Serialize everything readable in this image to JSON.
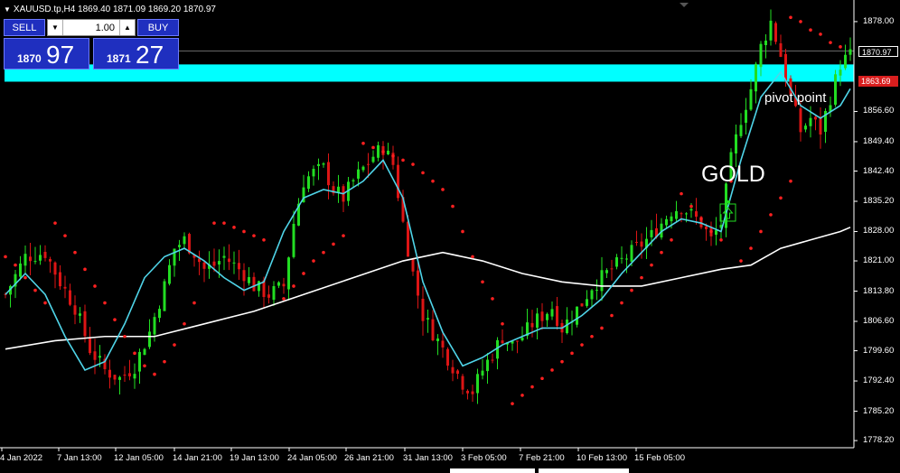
{
  "header": {
    "symbol_info": "XAUUSD.tp,H4  1869.40 1871.09 1869.20 1870.97"
  },
  "trade_panel": {
    "sell_label": "SELL",
    "buy_label": "BUY",
    "lot_value": "1.00",
    "sell_price_small": "1870",
    "sell_price_big": "97",
    "buy_price_small": "1871",
    "buy_price_big": "27"
  },
  "annotations": {
    "pivot_label": "pivot point",
    "gold_label": "GOLD"
  },
  "colors": {
    "background": "#000000",
    "bull_candle": "#22dd22",
    "bear_candle": "#dd1515",
    "ema_fast": "#4fd4e8",
    "ma_slow": "#ffffff",
    "sar": "#ff2020",
    "pivot_zone": "#00ffff",
    "pivot_tag": "#d91e1e",
    "signal_box": "#22dd22"
  },
  "chart_data": {
    "type": "candlestick",
    "price_axis": [
      "1878.00",
      "1870.97",
      "1863.69",
      "1856.60",
      "1849.40",
      "1842.40",
      "1835.20",
      "1828.00",
      "1821.00",
      "1813.80",
      "1806.60",
      "1799.60",
      "1792.40",
      "1785.20",
      "1778.20"
    ],
    "current_price": "1870.97",
    "pivot_price": "1863.69",
    "ylim": [
      1776.5,
      1882.5
    ],
    "pivot_zone": [
      1863.69,
      1867.8
    ],
    "time_axis": [
      "4 Jan 2022",
      "7 Jan 13:00",
      "12 Jan 05:00",
      "14 Jan 21:00",
      "19 Jan 13:00",
      "24 Jan 05:00",
      "26 Jan 21:00",
      "31 Jan 13:00",
      "3 Feb 05:00",
      "7 Feb 21:00",
      "10 Feb 13:00",
      "15 Feb 05:00"
    ],
    "close_path": [
      [
        0,
        1813
      ],
      [
        4,
        1822
      ],
      [
        8,
        1823
      ],
      [
        11,
        1816
      ],
      [
        14,
        1810
      ],
      [
        17,
        1800
      ],
      [
        20,
        1795
      ],
      [
        23,
        1793
      ],
      [
        26,
        1796
      ],
      [
        29,
        1804
      ],
      [
        32,
        1815
      ],
      [
        34,
        1824
      ],
      [
        36,
        1826
      ],
      [
        38,
        1823
      ],
      [
        40,
        1819
      ],
      [
        42,
        1820
      ],
      [
        44,
        1822
      ],
      [
        46,
        1820
      ],
      [
        48,
        1818
      ],
      [
        50,
        1815
      ],
      [
        53,
        1813
      ],
      [
        56,
        1815
      ],
      [
        58,
        1830
      ],
      [
        60,
        1840
      ],
      [
        62,
        1842
      ],
      [
        64,
        1843
      ],
      [
        66,
        1838
      ],
      [
        68,
        1836
      ],
      [
        70,
        1840
      ],
      [
        72,
        1843
      ],
      [
        74,
        1846
      ],
      [
        76,
        1848
      ],
      [
        78,
        1844
      ],
      [
        80,
        1830
      ],
      [
        82,
        1818
      ],
      [
        84,
        1808
      ],
      [
        86,
        1804
      ],
      [
        88,
        1800
      ],
      [
        90,
        1796
      ],
      [
        92,
        1792
      ],
      [
        94,
        1790
      ],
      [
        96,
        1795
      ],
      [
        98,
        1799
      ],
      [
        100,
        1803
      ],
      [
        102,
        1801
      ],
      [
        104,
        1803
      ],
      [
        106,
        1806
      ],
      [
        108,
        1808
      ],
      [
        110,
        1810
      ],
      [
        112,
        1805
      ],
      [
        114,
        1808
      ],
      [
        116,
        1811
      ],
      [
        118,
        1815
      ],
      [
        120,
        1817
      ],
      [
        122,
        1819
      ],
      [
        124,
        1821
      ],
      [
        126,
        1823
      ],
      [
        128,
        1825
      ],
      [
        130,
        1827
      ],
      [
        132,
        1830
      ],
      [
        134,
        1833
      ],
      [
        136,
        1834
      ],
      [
        138,
        1832
      ],
      [
        140,
        1830
      ],
      [
        142,
        1826
      ],
      [
        144,
        1830
      ],
      [
        146,
        1845
      ],
      [
        148,
        1855
      ],
      [
        150,
        1862
      ],
      [
        152,
        1872
      ],
      [
        154,
        1878
      ],
      [
        156,
        1870
      ],
      [
        158,
        1860
      ],
      [
        160,
        1852
      ],
      [
        162,
        1855
      ],
      [
        164,
        1852
      ],
      [
        166,
        1860
      ],
      [
        168,
        1868
      ],
      [
        170,
        1870
      ]
    ],
    "ema_fast": [
      [
        0,
        1813
      ],
      [
        4,
        1818
      ],
      [
        8,
        1813
      ],
      [
        12,
        1803
      ],
      [
        16,
        1795
      ],
      [
        20,
        1797
      ],
      [
        24,
        1806
      ],
      [
        28,
        1817
      ],
      [
        32,
        1822
      ],
      [
        36,
        1824
      ],
      [
        40,
        1821
      ],
      [
        44,
        1817
      ],
      [
        48,
        1814
      ],
      [
        52,
        1816
      ],
      [
        56,
        1828
      ],
      [
        60,
        1836
      ],
      [
        64,
        1838
      ],
      [
        68,
        1837
      ],
      [
        72,
        1840
      ],
      [
        76,
        1845
      ],
      [
        80,
        1836
      ],
      [
        84,
        1816
      ],
      [
        88,
        1804
      ],
      [
        92,
        1796
      ],
      [
        96,
        1798
      ],
      [
        100,
        1801
      ],
      [
        104,
        1803
      ],
      [
        108,
        1805
      ],
      [
        112,
        1805
      ],
      [
        116,
        1808
      ],
      [
        120,
        1812
      ],
      [
        124,
        1818
      ],
      [
        128,
        1823
      ],
      [
        132,
        1828
      ],
      [
        136,
        1831
      ],
      [
        140,
        1830
      ],
      [
        144,
        1828
      ],
      [
        148,
        1845
      ],
      [
        152,
        1860
      ],
      [
        156,
        1866
      ],
      [
        160,
        1858
      ],
      [
        164,
        1855
      ],
      [
        168,
        1858
      ],
      [
        170,
        1862
      ]
    ],
    "ma_slow": [
      [
        0,
        1800
      ],
      [
        10,
        1802
      ],
      [
        20,
        1803
      ],
      [
        30,
        1803
      ],
      [
        40,
        1806
      ],
      [
        50,
        1809
      ],
      [
        60,
        1813
      ],
      [
        70,
        1817
      ],
      [
        80,
        1821
      ],
      [
        88,
        1823
      ],
      [
        96,
        1821
      ],
      [
        104,
        1818
      ],
      [
        112,
        1816
      ],
      [
        120,
        1815
      ],
      [
        128,
        1815
      ],
      [
        136,
        1817
      ],
      [
        144,
        1819
      ],
      [
        150,
        1820
      ],
      [
        156,
        1824
      ],
      [
        162,
        1826
      ],
      [
        168,
        1828
      ],
      [
        170,
        1829
      ]
    ],
    "sar_up": [
      [
        0,
        1822
      ],
      [
        2,
        1820
      ],
      [
        4,
        1817
      ],
      [
        6,
        1814
      ],
      [
        8,
        1811
      ],
      [
        30,
        1794
      ],
      [
        32,
        1797
      ],
      [
        34,
        1801
      ],
      [
        36,
        1806
      ],
      [
        38,
        1811
      ],
      [
        56,
        1812
      ],
      [
        58,
        1815
      ],
      [
        60,
        1818
      ],
      [
        62,
        1821
      ],
      [
        64,
        1823
      ],
      [
        66,
        1825
      ],
      [
        68,
        1827
      ],
      [
        102,
        1787
      ],
      [
        104,
        1789
      ],
      [
        106,
        1791
      ],
      [
        108,
        1793
      ],
      [
        110,
        1795
      ],
      [
        112,
        1797
      ],
      [
        114,
        1799
      ],
      [
        116,
        1801
      ],
      [
        118,
        1803
      ],
      [
        120,
        1805
      ],
      [
        122,
        1808
      ],
      [
        124,
        1811
      ],
      [
        126,
        1814
      ],
      [
        128,
        1817
      ],
      [
        130,
        1820
      ],
      [
        132,
        1823
      ],
      [
        134,
        1826
      ],
      [
        148,
        1821
      ],
      [
        150,
        1824
      ],
      [
        152,
        1828
      ],
      [
        154,
        1832
      ],
      [
        156,
        1836
      ],
      [
        158,
        1840
      ]
    ],
    "sar_down": [
      [
        10,
        1830
      ],
      [
        12,
        1827
      ],
      [
        14,
        1823
      ],
      [
        16,
        1819
      ],
      [
        18,
        1815
      ],
      [
        20,
        1811
      ],
      [
        22,
        1807
      ],
      [
        24,
        1803
      ],
      [
        26,
        1799
      ],
      [
        28,
        1796
      ],
      [
        42,
        1830
      ],
      [
        44,
        1830
      ],
      [
        46,
        1829
      ],
      [
        48,
        1828
      ],
      [
        50,
        1827
      ],
      [
        52,
        1826
      ],
      [
        72,
        1849
      ],
      [
        74,
        1848
      ],
      [
        76,
        1847
      ],
      [
        78,
        1846
      ],
      [
        80,
        1845
      ],
      [
        82,
        1844
      ],
      [
        84,
        1842
      ],
      [
        86,
        1840
      ],
      [
        88,
        1838
      ],
      [
        90,
        1834
      ],
      [
        92,
        1828
      ],
      [
        94,
        1822
      ],
      [
        96,
        1816
      ],
      [
        98,
        1812
      ],
      [
        100,
        1806
      ],
      [
        136,
        1837
      ],
      [
        138,
        1834
      ],
      [
        140,
        1831
      ],
      [
        142,
        1828
      ],
      [
        144,
        1826
      ],
      [
        146,
        1840
      ],
      [
        158,
        1879
      ],
      [
        160,
        1878
      ],
      [
        162,
        1876
      ],
      [
        164,
        1875
      ],
      [
        166,
        1873
      ],
      [
        168,
        1872
      ]
    ]
  }
}
